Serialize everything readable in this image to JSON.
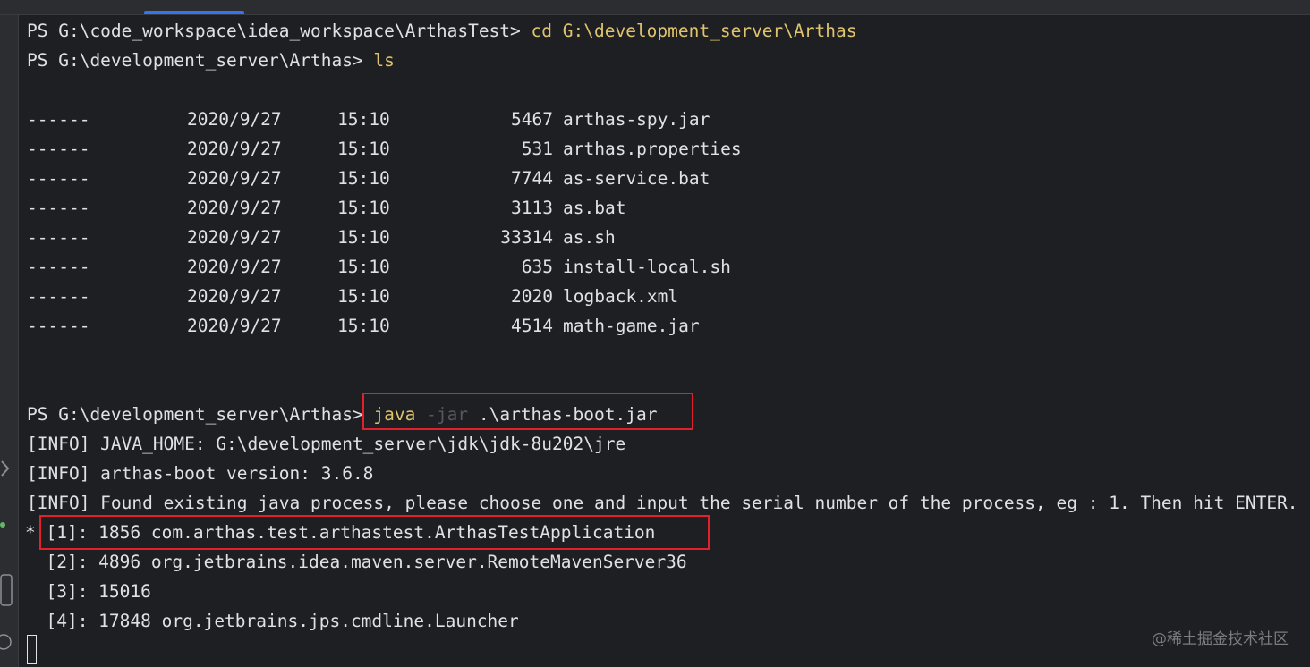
{
  "terminal": {
    "line1_prompt": "PS G:\\code_workspace\\idea_workspace\\ArthasTest> ",
    "line1_cmd": "cd G:\\development_server\\Arthas",
    "line2_prompt": "PS G:\\development_server\\Arthas> ",
    "line2_cmd": "ls",
    "listing": [
      {
        "mode": "------",
        "date": "2020/9/27",
        "time": "15:10",
        "size": "5467",
        "name": "arthas-spy.jar"
      },
      {
        "mode": "------",
        "date": "2020/9/27",
        "time": "15:10",
        "size": "531",
        "name": "arthas.properties"
      },
      {
        "mode": "------",
        "date": "2020/9/27",
        "time": "15:10",
        "size": "7744",
        "name": "as-service.bat"
      },
      {
        "mode": "------",
        "date": "2020/9/27",
        "time": "15:10",
        "size": "3113",
        "name": "as.bat"
      },
      {
        "mode": "------",
        "date": "2020/9/27",
        "time": "15:10",
        "size": "33314",
        "name": "as.sh"
      },
      {
        "mode": "------",
        "date": "2020/9/27",
        "time": "15:10",
        "size": "635",
        "name": "install-local.sh"
      },
      {
        "mode": "------",
        "date": "2020/9/27",
        "time": "15:10",
        "size": "2020",
        "name": "logback.xml"
      },
      {
        "mode": "------",
        "date": "2020/9/27",
        "time": "15:10",
        "size": "4514",
        "name": "math-game.jar"
      }
    ],
    "line3_prompt": "PS G:\\development_server\\Arthas> ",
    "line3_cmd": "java",
    "line3_flag": "-jar",
    "line3_arg": ".\\arthas-boot.jar",
    "info1": "[INFO] JAVA_HOME: G:\\development_server\\jdk\\jdk-8u202\\jre",
    "info2": "[INFO] arthas-boot version: 3.6.8",
    "info3": "[INFO] Found existing java process, please choose one and input the serial number of the process, eg : 1. Then hit ENTER.",
    "processes": [
      "* [1]: 1856 com.arthas.test.arthastest.ArthasTestApplication",
      "  [2]: 4896 org.jetbrains.idea.maven.server.RemoteMavenServer36",
      "  [3]: 15016",
      "  [4]: 17848 org.jetbrains.jps.cmdline.Launcher"
    ]
  },
  "watermark": "@稀土掘金技术社区",
  "colors": {
    "background": "#1e1f22",
    "text": "#dfe1e5",
    "command": "#e0c46c",
    "flag": "#56585e",
    "highlight_box": "#e0202a"
  }
}
